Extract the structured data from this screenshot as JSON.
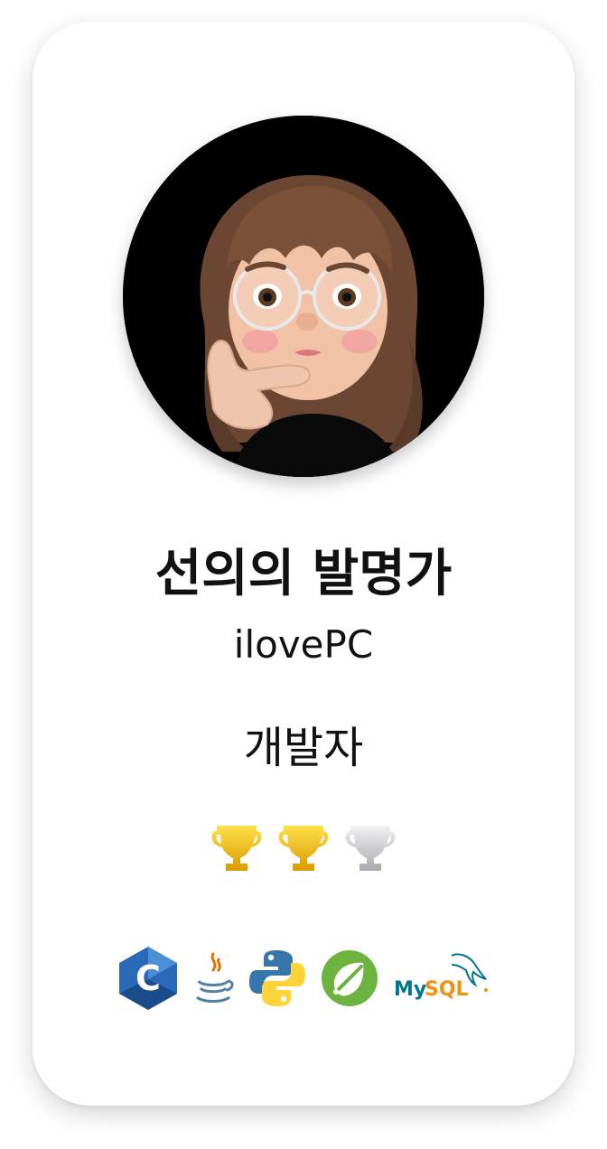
{
  "profile": {
    "name": "선의의 발명가",
    "handle": "ilovePC",
    "role": "개발자"
  },
  "trophies": [
    {
      "icon": "gold-trophy-icon",
      "color": "#E8B60C"
    },
    {
      "icon": "gold-trophy-icon",
      "color": "#E8B60C"
    },
    {
      "icon": "silver-trophy-icon",
      "color": "#C8C8CC"
    }
  ],
  "tech_stack": [
    {
      "icon": "c-language-icon",
      "color": "#1E5BA8"
    },
    {
      "icon": "java-icon",
      "color": "#E76F00"
    },
    {
      "icon": "python-icon",
      "color": "#3776AB"
    },
    {
      "icon": "spring-icon",
      "color": "#6DB33F"
    },
    {
      "icon": "mysql-icon",
      "label": "MySQL",
      "color": "#00758F"
    }
  ]
}
